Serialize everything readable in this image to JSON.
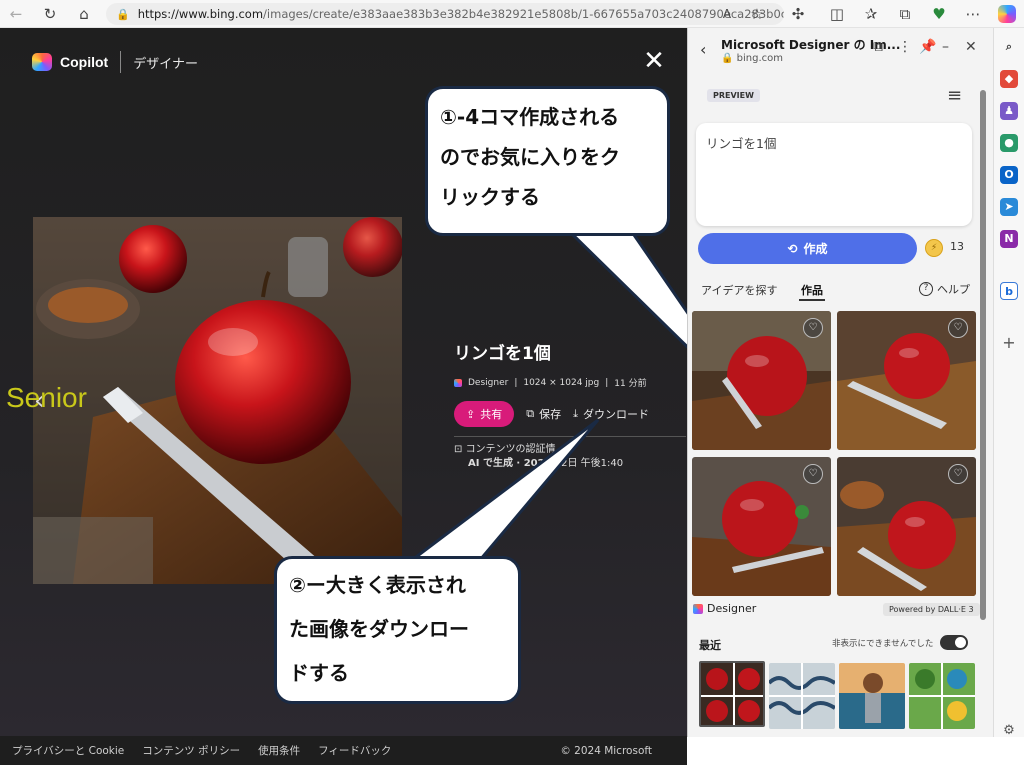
{
  "browser": {
    "url_host": "https://www.bing.com",
    "url_rest": "/images/create/e383aae383b3e382b4e382921e5808b/1-667655a703c2408790eca283b0c552e...",
    "read_aloud": "A"
  },
  "brand": {
    "copilot": "Copilot",
    "designer": "デザイナー"
  },
  "main": {
    "title": "リンゴを1個",
    "meta_designer": "Designer",
    "meta_size": "1024 × 1024 jpg",
    "meta_time": "11 分前",
    "share": "共有",
    "save": "保存",
    "download": "ダウンロード",
    "cred_line1": "コンテンツの認証情",
    "cred_line2": "AI で生成 · 2024",
    "cred_line2b": "22日 午後1:40",
    "nav_prev": "‹"
  },
  "watermark": "Senior",
  "callouts": {
    "c1_line1": "①-4コマ作成される",
    "c1_line2": "のでお気に入りをク",
    "c1_line3": "リックする",
    "c2_line1": "②ー大きく表示され",
    "c2_line2": "た画像をダウンロー",
    "c2_line3": "ドする"
  },
  "footer": {
    "privacy": "プライバシーと Cookie",
    "content_policy": "コンテンツ ポリシー",
    "terms": "使用条件",
    "feedback": "フィードバック",
    "copyright": "© 2024 Microsoft"
  },
  "panel": {
    "title": "Microsoft Designer の Im...",
    "subtitle": "bing.com",
    "preview": "PREVIEW",
    "prompt": "リンゴを1個",
    "create": "作成",
    "coins": "13",
    "tab_ideas": "アイデアを探す",
    "tab_works": "作品",
    "help": "ヘルプ",
    "designer": "Designer",
    "dalle": "Powered by DALL·E 3",
    "recent": "最近",
    "no_hide": "非表示にできませんでした"
  },
  "colors": {
    "accent_blue": "#4f6fe8",
    "share_pink": "#d81b7a",
    "callout_border": "#1a2a44"
  }
}
